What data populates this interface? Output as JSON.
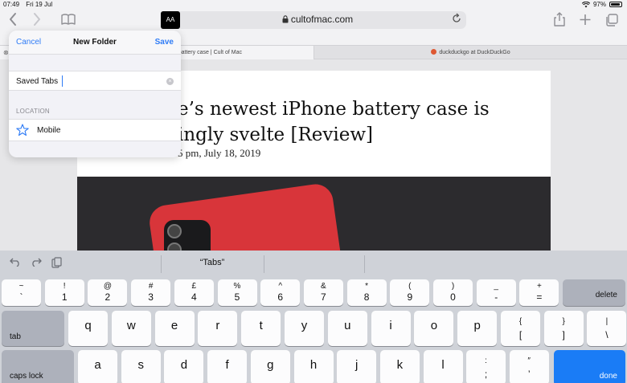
{
  "status_bar": {
    "time": "07:49",
    "date": "Fri 19 Jul",
    "battery": "97%"
  },
  "browser": {
    "url": "cultofmac.com",
    "reader_button": "AA",
    "icons": [
      "chevron-left-icon",
      "chevron-right-icon",
      "book-icon",
      "lock-icon",
      "reload-icon",
      "share-icon",
      "plus-icon",
      "tabs-icon"
    ],
    "tabs": [
      {
        "title": "ne battery case | Cult of Mac"
      },
      {
        "title": "duckduckgo at DuckDuckGo"
      }
    ]
  },
  "article": {
    "headline_line1": "e’s newest iPhone battery case is",
    "headline_line2": "ingly svelte [Review]",
    "byline": "5 pm, July 18, 2019",
    "colors": {
      "case": "#d8353a"
    }
  },
  "popover": {
    "cancel": "Cancel",
    "title": "New Folder",
    "save": "Save",
    "folder_name": "Saved Tabs",
    "location_label": "LOCATION",
    "location_value": "Mobile",
    "accent": "#2f7cf6"
  },
  "keyboard": {
    "suggestion": "“Tabs”",
    "number_row": [
      {
        "top": "~",
        "bottom": "`"
      },
      {
        "top": "!",
        "bottom": "1"
      },
      {
        "top": "@",
        "bottom": "2"
      },
      {
        "top": "#",
        "bottom": "3"
      },
      {
        "top": "£",
        "bottom": "4"
      },
      {
        "top": "%",
        "bottom": "5"
      },
      {
        "top": "^",
        "bottom": "6"
      },
      {
        "top": "&",
        "bottom": "7"
      },
      {
        "top": "*",
        "bottom": "8"
      },
      {
        "top": "(",
        "bottom": "9"
      },
      {
        "top": ")",
        "bottom": "0"
      },
      {
        "top": "_",
        "bottom": "-"
      },
      {
        "top": "+",
        "bottom": "="
      }
    ],
    "delete": "delete",
    "tab": "tab",
    "top_row": [
      "q",
      "w",
      "e",
      "r",
      "t",
      "y",
      "u",
      "i",
      "o",
      "p"
    ],
    "top_row_symbols": [
      {
        "top": "{",
        "bottom": "["
      },
      {
        "top": "}",
        "bottom": "]"
      },
      {
        "top": "|",
        "bottom": "\\"
      }
    ],
    "caps_lock": "caps lock",
    "home_row": [
      "a",
      "s",
      "d",
      "f",
      "g",
      "h",
      "j",
      "k",
      "l"
    ],
    "home_row_symbols": [
      {
        "top": ":",
        "bottom": ";"
      },
      {
        "top": "″",
        "bottom": "’"
      }
    ],
    "done": "done"
  }
}
